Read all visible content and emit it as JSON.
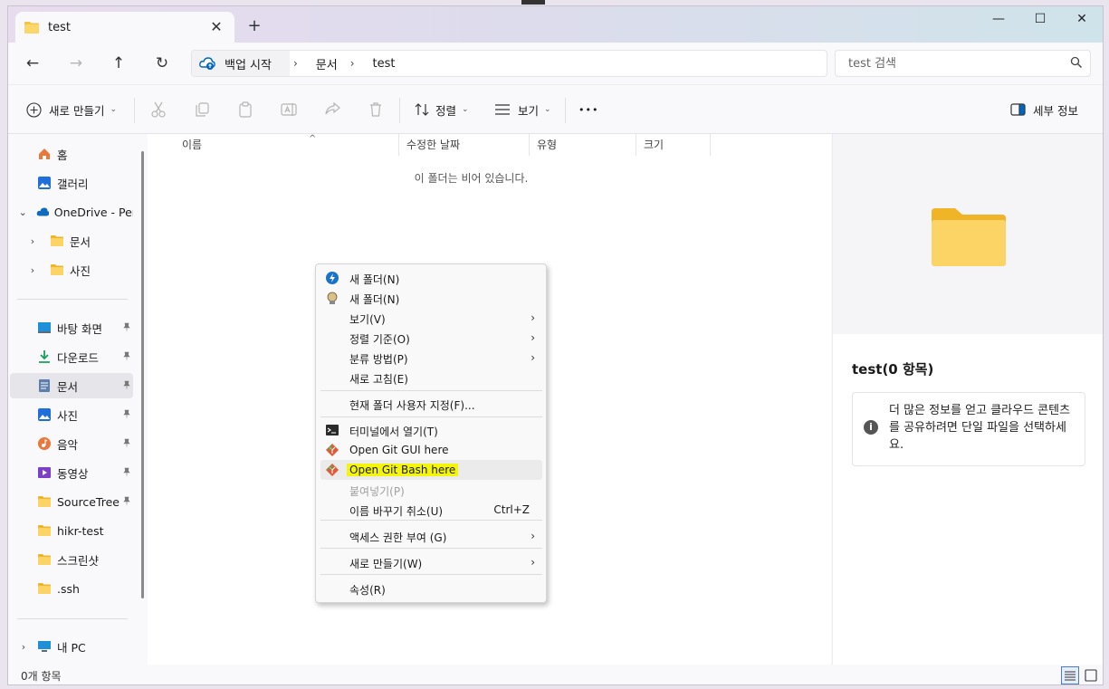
{
  "tab": {
    "title": "test",
    "close": "✕",
    "new": "+"
  },
  "window_controls": {
    "minimize": "—",
    "maximize": "☐",
    "close": "✕"
  },
  "nav": {
    "back": "←",
    "forward": "→",
    "up": "↑",
    "refresh": "↻",
    "breadcrumbs": [
      "백업 시작",
      "문서",
      "test"
    ],
    "sep": "›",
    "search_placeholder": "test 검색"
  },
  "toolbar": {
    "new_label": "새로 만들기",
    "sort_label": "정렬",
    "view_label": "보기",
    "more_label": "•••",
    "details_label": "세부 정보",
    "chev": "⌄"
  },
  "sidebar": {
    "items": [
      {
        "label": "홈",
        "icon": "home-icon"
      },
      {
        "label": "갤러리",
        "icon": "gallery-icon"
      },
      {
        "label": "OneDrive - Pers",
        "icon": "cloud-icon",
        "chevron": "⌄"
      },
      {
        "label": "문서",
        "icon": "folder-icon",
        "chevron": "›"
      },
      {
        "label": "사진",
        "icon": "folder-icon",
        "chevron": "›"
      },
      {
        "label": "바탕 화면",
        "icon": "desktop-icon",
        "pinned": true
      },
      {
        "label": "다운로드",
        "icon": "download-icon",
        "pinned": true
      },
      {
        "label": "문서",
        "icon": "document-icon",
        "pinned": true,
        "selected": true
      },
      {
        "label": "사진",
        "icon": "pictures-icon",
        "pinned": true
      },
      {
        "label": "음악",
        "icon": "music-icon",
        "pinned": true
      },
      {
        "label": "동영상",
        "icon": "video-icon",
        "pinned": true
      },
      {
        "label": "SourceTree",
        "icon": "folder-icon",
        "pinned": true
      },
      {
        "label": "hikr-test",
        "icon": "folder-icon"
      },
      {
        "label": "스크린샷",
        "icon": "folder-icon"
      },
      {
        "label": ".ssh",
        "icon": "folder-icon"
      },
      {
        "label": "내 PC",
        "icon": "pc-icon",
        "chevron": "›"
      }
    ],
    "pin": "📌"
  },
  "content": {
    "columns": [
      "이름",
      "수정한 날짜",
      "유형",
      "크기"
    ],
    "sort_indicator": "^",
    "empty_message": "이 폴더는 비어 있습니다."
  },
  "preview": {
    "title": "test(0 항목)",
    "info_icon": "i",
    "info_text": "더 많은 정보를 얻고 클라우드 콘텐츠를 공유하려면 단일 파일을 선택하세요."
  },
  "status": {
    "count": "0개 항목"
  },
  "context_menu": {
    "items": [
      {
        "label": "새 폴더(N)",
        "icon": "tortoise-icon"
      },
      {
        "label": "새 폴더(N)",
        "icon": "bulb-icon"
      },
      {
        "label": "보기(V)",
        "submenu": true
      },
      {
        "label": "정렬 기준(O)",
        "submenu": true
      },
      {
        "label": "분류 방법(P)",
        "submenu": true
      },
      {
        "label": "새로 고침(E)"
      },
      {
        "label": "현재 폴더 사용자 지정(F)..."
      },
      {
        "label": "터미널에서 열기(T)",
        "icon": "terminal-icon"
      },
      {
        "label": "Open Git GUI here",
        "icon": "git-icon"
      },
      {
        "label": "Open Git Bash here",
        "icon": "git-icon",
        "hover": true,
        "highlight": true
      },
      {
        "label": "붙여넣기(P)",
        "disabled": true
      },
      {
        "label": "이름 바꾸기 취소(U)",
        "shortcut": "Ctrl+Z"
      },
      {
        "label": "액세스 권한 부여 (G)",
        "submenu": true
      },
      {
        "label": "새로 만들기(W)",
        "submenu": true
      },
      {
        "label": "속성(R)"
      }
    ],
    "arrow": "›"
  },
  "colors": {
    "accent": "#0067c0",
    "folder": "#f5c542",
    "highlight": "#f5f50a"
  }
}
